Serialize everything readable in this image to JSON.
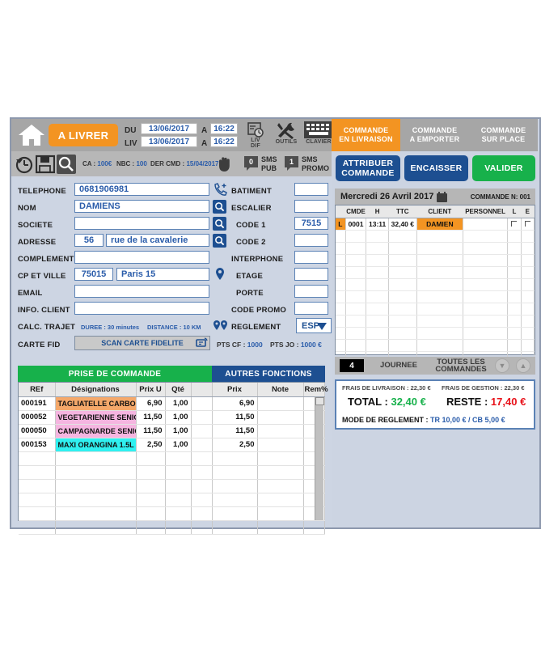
{
  "header": {
    "home_icon": "home-icon",
    "status_button": "A LIVRER",
    "du_label": "DU",
    "liv_label": "LIV",
    "a_label_1": "A",
    "a_label_2": "A",
    "du_date": "13/06/2017",
    "du_time": "16:22",
    "liv_date": "13/06/2017",
    "liv_time": "16:22",
    "livdif_caption_1": "LIV",
    "livdif_caption_2": "DIF",
    "outils_caption": "OUTILS",
    "clavier_caption": "CLAVIER"
  },
  "toolbar2": {
    "history_icon": "clock-history-icon",
    "save_icon": "save-icon",
    "search_icon": "search-icon",
    "ca_label": "CA :",
    "ca_value": "100€",
    "nbc_label": "NBC :",
    "nbc_value": "100",
    "dercmd_label": "DER CMD :",
    "dercmd_value": "15/04/2017",
    "hand_icon": "hand-stop-icon",
    "sms_pub_count": "0",
    "sms_pub_line1": "SMS",
    "sms_pub_line2": "PUB",
    "sms_promo_count": "1",
    "sms_promo_line1": "SMS",
    "sms_promo_line2": "PROMO"
  },
  "form": {
    "telephone_label": "TELEPHONE",
    "telephone_value": "0681906981",
    "nom_label": "NOM",
    "nom_value": "DAMIENS",
    "societe_label": "SOCIETE",
    "societe_value": "",
    "adresse_label": "ADRESSE",
    "adresse_num": "56",
    "adresse_rue": "rue de la cavalerie",
    "complement_label": "COMPLEMENT",
    "complement_value": "",
    "cpville_label": "CP ET VILLE",
    "cp_value": "75015",
    "ville_value": "Paris 15",
    "email_label": "EMAIL",
    "email_value": "",
    "infoclient_label": "INFO. CLIENT",
    "infoclient_value": "",
    "calctrajet_label": "CALC. TRAJET",
    "duree_text": "DUREE : 30 minutes",
    "distance_text": "DISTANCE : 10 KM",
    "cartefid_label": "CARTE FID",
    "scan_button": "SCAN CARTE FIDELITE",
    "pts_cf_label": "PTS CF :",
    "pts_cf_value": "1000",
    "pts_jo_label": "PTS  JO :",
    "pts_jo_value": "1000 €",
    "batiment_label": "BATIMENT",
    "batiment_value": "",
    "escalier_label": "ESCALIER",
    "escalier_value": "",
    "code1_label": "CODE 1",
    "code1_value": "7515",
    "code2_label": "CODE 2",
    "code2_value": "",
    "interphone_label": "INTERPHONE",
    "interphone_value": "",
    "etage_label": "ETAGE",
    "etage_value": "",
    "porte_label": "PORTE",
    "porte_value": "",
    "codepromo_label": "CODE PROMO",
    "codepromo_value": "",
    "reglement_label": "REGLEMENT",
    "reglement_value": "ESP"
  },
  "tabs": {
    "prise_de_commande": "PRISE DE COMMANDE",
    "autres_fonctions": "AUTRES FONCTIONS"
  },
  "items_table": {
    "columns": [
      "REf",
      "Désignations",
      "Prix U",
      "Qté",
      "",
      "Prix",
      "Note",
      "Rem%"
    ],
    "rows": [
      {
        "ref": "000191",
        "designation": "TAGLIATELLE CARBONARA",
        "color": "#f5a86a",
        "prix_u": "6,90",
        "qte": "1,00",
        "blank": "",
        "prix": "6,90",
        "note": "",
        "rem": ""
      },
      {
        "ref": "000052",
        "designation": "VEGETARIENNE SENIOR",
        "color": "#f5b5e0",
        "prix_u": "11,50",
        "qte": "1,00",
        "blank": "",
        "prix": "11,50",
        "note": "",
        "rem": ""
      },
      {
        "ref": "000050",
        "designation": "CAMPAGNARDE SENIOR",
        "color": "#f5b5e0",
        "prix_u": "11,50",
        "qte": "1,00",
        "blank": "",
        "prix": "11,50",
        "note": "",
        "rem": ""
      },
      {
        "ref": "000153",
        "designation": "MAXI ORANGINA 1.5L",
        "color": "#2ff0f0",
        "prix_u": "2,50",
        "qte": "1,00",
        "blank": "",
        "prix": "2,50",
        "note": "",
        "rem": ""
      }
    ],
    "empty_rows": 6
  },
  "right": {
    "tab_livraison_l1": "COMMANDE",
    "tab_livraison_l2": "EN LIVRAISON",
    "tab_emporter_l1": "COMMANDE",
    "tab_emporter_l2": "A EMPORTER",
    "tab_surplace_l1": "COMMANDE",
    "tab_surplace_l2": "SUR PLACE",
    "btn_attribuer_l1": "ATTRIBUER",
    "btn_attribuer_l2": "COMMANDE",
    "btn_encaisser": "ENCAISSER",
    "btn_valider": "VALIDER",
    "date_text": "Mercredi  26  Avril 2017",
    "commande_no": "COMMANDE N: 001",
    "orders_columns": [
      "",
      "CMDE",
      "H",
      "TTC",
      "CLIENT",
      "PERSONNEL",
      "L",
      "E"
    ],
    "orders_rows": [
      {
        "flag": "L",
        "cmde": "0001",
        "h": "13:11",
        "ttc": "32,40 €",
        "client": "DAMIEN",
        "personnel": "",
        "l": "check",
        "e": "check"
      }
    ],
    "orders_empty_rows": 11,
    "nav_count": "4",
    "nav_journee": "JOURNEE",
    "nav_toutes_l1": "TOUTES LES",
    "nav_toutes_l2": "COMMANDES",
    "nav_down_icon": "chevron-down-icon",
    "nav_up_icon": "chevron-up-icon",
    "frais_livraison": "FRAIS DE LIVRAISON : 22,30 €",
    "frais_gestion": "FRAIS DE GESTION : 22,30 €",
    "total_label": "TOTAL :",
    "total_value": "32,40 €",
    "reste_label": "RESTE :",
    "reste_value": "17,40 €",
    "mode_label": "MODE DE REGLEMENT :",
    "mode_value": "TR  10,00 €  / CB 5,00 €"
  },
  "colors": {
    "orange": "#f39422",
    "blue": "#1d4f91",
    "green": "#17b14b",
    "red": "#e8121a",
    "gray_toolbar": "#a6a6a6",
    "panel_bg": "#ccd4e2"
  }
}
